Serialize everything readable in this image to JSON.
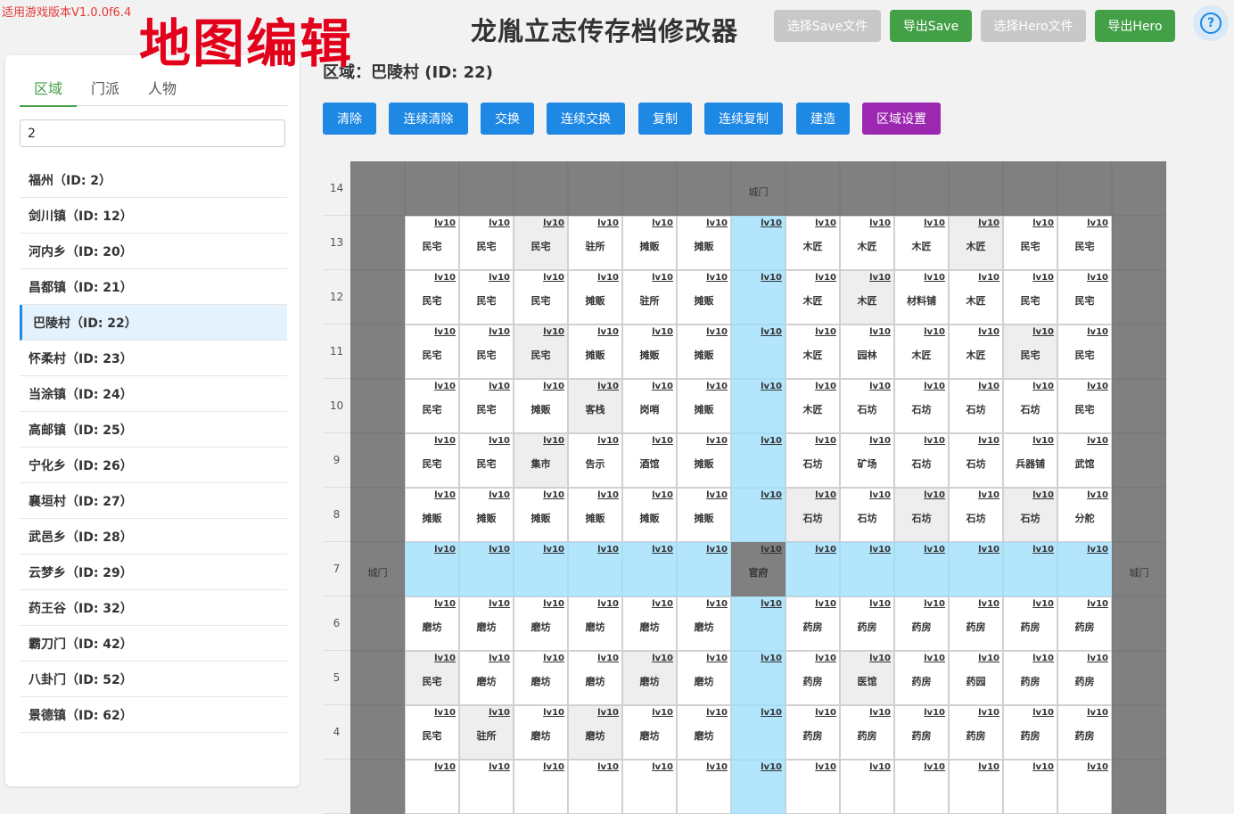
{
  "version_text": "适用游戏版本V1.0.0f6.4",
  "watermark": "地图编辑",
  "app_title": "龙胤立志传存档修改器",
  "header_buttons": [
    {
      "label": "选择Save文件",
      "style": "gray"
    },
    {
      "label": "导出Save",
      "style": "green"
    },
    {
      "label": "选择Hero文件",
      "style": "gray"
    },
    {
      "label": "导出Hero",
      "style": "green"
    }
  ],
  "help_icon": "question-circle-icon",
  "tabs": [
    {
      "label": "区域",
      "active": true
    },
    {
      "label": "门派",
      "active": false
    },
    {
      "label": "人物",
      "active": false
    }
  ],
  "search": {
    "value": "2",
    "placeholder": ""
  },
  "regions": [
    {
      "label": "福州（ID: 2）",
      "active": false
    },
    {
      "label": "剑川镇（ID: 12）",
      "active": false
    },
    {
      "label": "河内乡（ID: 20）",
      "active": false
    },
    {
      "label": "昌都镇（ID: 21）",
      "active": false
    },
    {
      "label": "巴陵村（ID: 22）",
      "active": true
    },
    {
      "label": "怀柔村（ID: 23）",
      "active": false
    },
    {
      "label": "当涂镇（ID: 24）",
      "active": false
    },
    {
      "label": "高邮镇（ID: 25）",
      "active": false
    },
    {
      "label": "宁化乡（ID: 26）",
      "active": false
    },
    {
      "label": "襄垣村（ID: 27）",
      "active": false
    },
    {
      "label": "武邑乡（ID: 28）",
      "active": false
    },
    {
      "label": "云梦乡（ID: 29）",
      "active": false
    },
    {
      "label": "药王谷（ID: 32）",
      "active": false
    },
    {
      "label": "霸刀门（ID: 42）",
      "active": false
    },
    {
      "label": "八卦门（ID: 52）",
      "active": false
    },
    {
      "label": "景德镇（ID: 62）",
      "active": false
    }
  ],
  "region_title": "区域：巴陵村 (ID: 22)",
  "action_buttons": [
    {
      "label": "清除",
      "color": "#1e88e5"
    },
    {
      "label": "连续清除",
      "color": "#1e88e5"
    },
    {
      "label": "交换",
      "color": "#1e88e5"
    },
    {
      "label": "连续交换",
      "color": "#1e88e5"
    },
    {
      "label": "复制",
      "color": "#1e88e5"
    },
    {
      "label": "连续复制",
      "color": "#1e88e5"
    },
    {
      "label": "建造",
      "color": "#1e88e5"
    },
    {
      "label": "区域设置",
      "color": "#9c27b0"
    }
  ],
  "level_label": "lv10",
  "grid_rows": [
    {
      "row": "14",
      "cells": [
        {
          "t": "d"
        },
        {
          "t": "d"
        },
        {
          "t": "d"
        },
        {
          "t": "d"
        },
        {
          "t": "d"
        },
        {
          "t": "d"
        },
        {
          "t": "d"
        },
        {
          "t": "d",
          "name": "城门",
          "gate": true
        },
        {
          "t": "d"
        },
        {
          "t": "d"
        },
        {
          "t": "d"
        },
        {
          "t": "d"
        },
        {
          "t": "d"
        },
        {
          "t": "d"
        },
        {
          "t": "d"
        }
      ]
    },
    {
      "row": "13",
      "cells": [
        {
          "t": "d"
        },
        {
          "t": "w",
          "name": "民宅",
          "lv": true
        },
        {
          "t": "w",
          "name": "民宅",
          "lv": true
        },
        {
          "t": "g",
          "name": "民宅",
          "lv": true
        },
        {
          "t": "w",
          "name": "驻所",
          "lv": true
        },
        {
          "t": "w",
          "name": "摊贩",
          "lv": true
        },
        {
          "t": "w",
          "name": "摊贩",
          "lv": true
        },
        {
          "t": "r",
          "lv": true
        },
        {
          "t": "w",
          "name": "木匠",
          "lv": true
        },
        {
          "t": "w",
          "name": "木匠",
          "lv": true
        },
        {
          "t": "w",
          "name": "木匠",
          "lv": true
        },
        {
          "t": "g",
          "name": "木匠",
          "lv": true
        },
        {
          "t": "w",
          "name": "民宅",
          "lv": true
        },
        {
          "t": "w",
          "name": "民宅",
          "lv": true
        },
        {
          "t": "d"
        }
      ]
    },
    {
      "row": "12",
      "cells": [
        {
          "t": "d"
        },
        {
          "t": "w",
          "name": "民宅",
          "lv": true
        },
        {
          "t": "w",
          "name": "民宅",
          "lv": true
        },
        {
          "t": "w",
          "name": "民宅",
          "lv": true
        },
        {
          "t": "w",
          "name": "摊贩",
          "lv": true
        },
        {
          "t": "w",
          "name": "驻所",
          "lv": true
        },
        {
          "t": "w",
          "name": "摊贩",
          "lv": true
        },
        {
          "t": "r",
          "lv": true
        },
        {
          "t": "w",
          "name": "木匠",
          "lv": true
        },
        {
          "t": "g",
          "name": "木匠",
          "lv": true
        },
        {
          "t": "w",
          "name": "材料铺",
          "lv": true
        },
        {
          "t": "w",
          "name": "木匠",
          "lv": true
        },
        {
          "t": "w",
          "name": "民宅",
          "lv": true
        },
        {
          "t": "w",
          "name": "民宅",
          "lv": true
        },
        {
          "t": "d"
        }
      ]
    },
    {
      "row": "11",
      "cells": [
        {
          "t": "d"
        },
        {
          "t": "w",
          "name": "民宅",
          "lv": true
        },
        {
          "t": "w",
          "name": "民宅",
          "lv": true
        },
        {
          "t": "g",
          "name": "民宅",
          "lv": true
        },
        {
          "t": "w",
          "name": "摊贩",
          "lv": true
        },
        {
          "t": "w",
          "name": "摊贩",
          "lv": true
        },
        {
          "t": "w",
          "name": "摊贩",
          "lv": true
        },
        {
          "t": "r",
          "lv": true
        },
        {
          "t": "w",
          "name": "木匠",
          "lv": true
        },
        {
          "t": "w",
          "name": "园林",
          "lv": true
        },
        {
          "t": "w",
          "name": "木匠",
          "lv": true
        },
        {
          "t": "w",
          "name": "木匠",
          "lv": true
        },
        {
          "t": "g",
          "name": "民宅",
          "lv": true
        },
        {
          "t": "w",
          "name": "民宅",
          "lv": true
        },
        {
          "t": "d"
        }
      ]
    },
    {
      "row": "10",
      "cells": [
        {
          "t": "d"
        },
        {
          "t": "w",
          "name": "民宅",
          "lv": true
        },
        {
          "t": "w",
          "name": "民宅",
          "lv": true
        },
        {
          "t": "w",
          "name": "摊贩",
          "lv": true
        },
        {
          "t": "g",
          "name": "客栈",
          "lv": true
        },
        {
          "t": "w",
          "name": "岗哨",
          "lv": true
        },
        {
          "t": "w",
          "name": "摊贩",
          "lv": true
        },
        {
          "t": "r",
          "lv": true
        },
        {
          "t": "w",
          "name": "木匠",
          "lv": true
        },
        {
          "t": "w",
          "name": "石坊",
          "lv": true
        },
        {
          "t": "w",
          "name": "石坊",
          "lv": true
        },
        {
          "t": "w",
          "name": "石坊",
          "lv": true
        },
        {
          "t": "w",
          "name": "石坊",
          "lv": true
        },
        {
          "t": "w",
          "name": "民宅",
          "lv": true
        },
        {
          "t": "d"
        }
      ]
    },
    {
      "row": "9",
      "cells": [
        {
          "t": "d"
        },
        {
          "t": "w",
          "name": "民宅",
          "lv": true
        },
        {
          "t": "w",
          "name": "民宅",
          "lv": true
        },
        {
          "t": "g",
          "name": "集市",
          "lv": true
        },
        {
          "t": "w",
          "name": "告示",
          "lv": true
        },
        {
          "t": "w",
          "name": "酒馆",
          "lv": true
        },
        {
          "t": "w",
          "name": "摊贩",
          "lv": true
        },
        {
          "t": "r",
          "lv": true
        },
        {
          "t": "w",
          "name": "石坊",
          "lv": true
        },
        {
          "t": "w",
          "name": "矿场",
          "lv": true
        },
        {
          "t": "w",
          "name": "石坊",
          "lv": true
        },
        {
          "t": "w",
          "name": "石坊",
          "lv": true
        },
        {
          "t": "w",
          "name": "兵器铺",
          "lv": true
        },
        {
          "t": "w",
          "name": "武馆",
          "lv": true
        },
        {
          "t": "d"
        }
      ]
    },
    {
      "row": "8",
      "cells": [
        {
          "t": "d"
        },
        {
          "t": "w",
          "name": "摊贩",
          "lv": true
        },
        {
          "t": "w",
          "name": "摊贩",
          "lv": true
        },
        {
          "t": "w",
          "name": "摊贩",
          "lv": true
        },
        {
          "t": "w",
          "name": "摊贩",
          "lv": true
        },
        {
          "t": "w",
          "name": "摊贩",
          "lv": true
        },
        {
          "t": "w",
          "name": "摊贩",
          "lv": true
        },
        {
          "t": "r",
          "lv": true
        },
        {
          "t": "g",
          "name": "石坊",
          "lv": true
        },
        {
          "t": "w",
          "name": "石坊",
          "lv": true
        },
        {
          "t": "g",
          "name": "石坊",
          "lv": true
        },
        {
          "t": "w",
          "name": "石坊",
          "lv": true
        },
        {
          "t": "g",
          "name": "石坊",
          "lv": true
        },
        {
          "t": "w",
          "name": "分舵",
          "lv": true
        },
        {
          "t": "d"
        }
      ]
    },
    {
      "row": "7",
      "cells": [
        {
          "t": "d",
          "name": "城门",
          "gate": true
        },
        {
          "t": "r",
          "lv": true
        },
        {
          "t": "r",
          "lv": true
        },
        {
          "t": "r",
          "lv": true
        },
        {
          "t": "r",
          "lv": true
        },
        {
          "t": "r",
          "lv": true
        },
        {
          "t": "r",
          "lv": true
        },
        {
          "t": "d",
          "name": "官府",
          "lv": true
        },
        {
          "t": "r",
          "lv": true
        },
        {
          "t": "r",
          "lv": true
        },
        {
          "t": "r",
          "lv": true
        },
        {
          "t": "r",
          "lv": true
        },
        {
          "t": "r",
          "lv": true
        },
        {
          "t": "r",
          "lv": true
        },
        {
          "t": "d",
          "name": "城门",
          "gate": true
        }
      ]
    },
    {
      "row": "6",
      "cells": [
        {
          "t": "d"
        },
        {
          "t": "w",
          "name": "磨坊",
          "lv": true
        },
        {
          "t": "w",
          "name": "磨坊",
          "lv": true
        },
        {
          "t": "w",
          "name": "磨坊",
          "lv": true
        },
        {
          "t": "w",
          "name": "磨坊",
          "lv": true
        },
        {
          "t": "w",
          "name": "磨坊",
          "lv": true
        },
        {
          "t": "w",
          "name": "磨坊",
          "lv": true
        },
        {
          "t": "r",
          "lv": true
        },
        {
          "t": "w",
          "name": "药房",
          "lv": true
        },
        {
          "t": "w",
          "name": "药房",
          "lv": true
        },
        {
          "t": "w",
          "name": "药房",
          "lv": true
        },
        {
          "t": "w",
          "name": "药房",
          "lv": true
        },
        {
          "t": "w",
          "name": "药房",
          "lv": true
        },
        {
          "t": "w",
          "name": "药房",
          "lv": true
        },
        {
          "t": "d"
        }
      ]
    },
    {
      "row": "5",
      "cells": [
        {
          "t": "d"
        },
        {
          "t": "g",
          "name": "民宅",
          "lv": true
        },
        {
          "t": "w",
          "name": "磨坊",
          "lv": true
        },
        {
          "t": "w",
          "name": "磨坊",
          "lv": true
        },
        {
          "t": "w",
          "name": "磨坊",
          "lv": true
        },
        {
          "t": "g",
          "name": "磨坊",
          "lv": true
        },
        {
          "t": "w",
          "name": "磨坊",
          "lv": true
        },
        {
          "t": "r",
          "lv": true
        },
        {
          "t": "w",
          "name": "药房",
          "lv": true
        },
        {
          "t": "g",
          "name": "医馆",
          "lv": true
        },
        {
          "t": "w",
          "name": "药房",
          "lv": true
        },
        {
          "t": "w",
          "name": "药园",
          "lv": true
        },
        {
          "t": "w",
          "name": "药房",
          "lv": true
        },
        {
          "t": "w",
          "name": "药房",
          "lv": true
        },
        {
          "t": "d"
        }
      ]
    },
    {
      "row": "4",
      "cells": [
        {
          "t": "d"
        },
        {
          "t": "w",
          "name": "民宅",
          "lv": true
        },
        {
          "t": "g",
          "name": "驻所",
          "lv": true
        },
        {
          "t": "w",
          "name": "磨坊",
          "lv": true
        },
        {
          "t": "g",
          "name": "磨坊",
          "lv": true
        },
        {
          "t": "w",
          "name": "磨坊",
          "lv": true
        },
        {
          "t": "w",
          "name": "磨坊",
          "lv": true
        },
        {
          "t": "r",
          "lv": true
        },
        {
          "t": "w",
          "name": "药房",
          "lv": true
        },
        {
          "t": "w",
          "name": "药房",
          "lv": true
        },
        {
          "t": "w",
          "name": "药房",
          "lv": true
        },
        {
          "t": "w",
          "name": "药房",
          "lv": true
        },
        {
          "t": "w",
          "name": "药房",
          "lv": true
        },
        {
          "t": "w",
          "name": "药房",
          "lv": true
        },
        {
          "t": "d"
        }
      ]
    },
    {
      "row": "",
      "cells": [
        {
          "t": "d"
        },
        {
          "t": "w",
          "lv": true
        },
        {
          "t": "w",
          "lv": true
        },
        {
          "t": "w",
          "lv": true
        },
        {
          "t": "w",
          "lv": true
        },
        {
          "t": "w",
          "lv": true
        },
        {
          "t": "w",
          "lv": true
        },
        {
          "t": "r",
          "lv": true
        },
        {
          "t": "w",
          "lv": true
        },
        {
          "t": "w",
          "lv": true
        },
        {
          "t": "w",
          "lv": true
        },
        {
          "t": "w",
          "lv": true
        },
        {
          "t": "w",
          "lv": true
        },
        {
          "t": "w",
          "lv": true
        },
        {
          "t": "d"
        }
      ]
    }
  ]
}
